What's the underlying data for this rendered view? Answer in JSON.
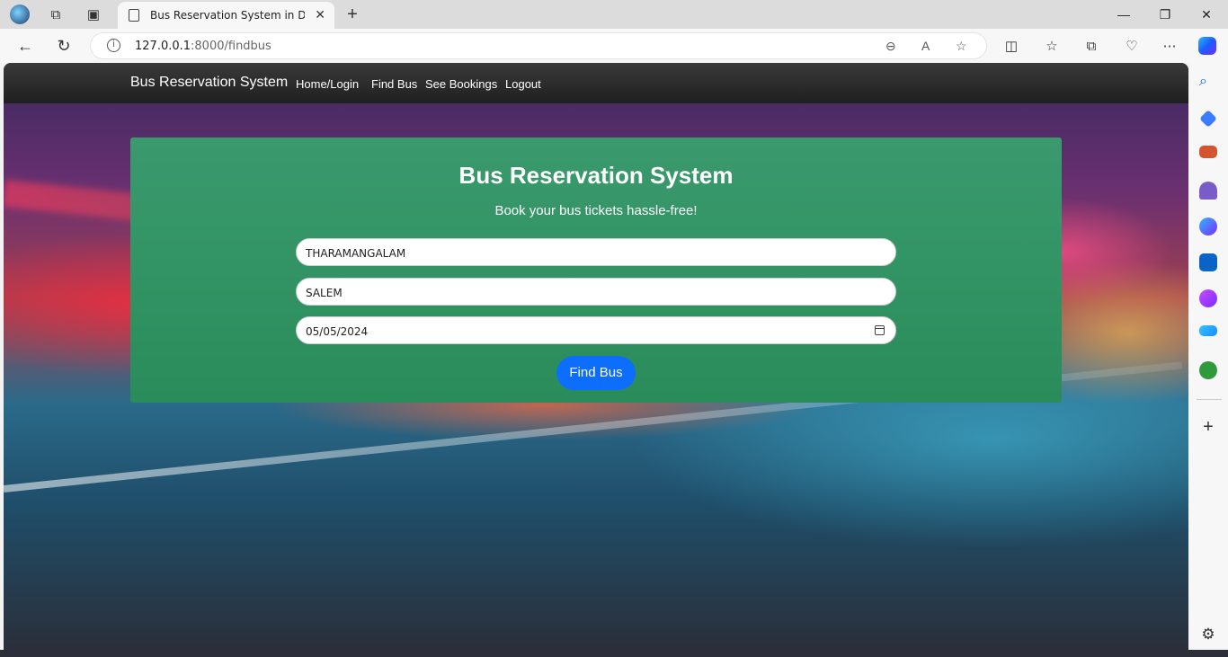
{
  "browser": {
    "tab_title": "Bus Reservation System in Django",
    "url_host": "127.0.0.1",
    "url_rest": ":8000/findbus"
  },
  "site": {
    "brand": "Bus Reservation System",
    "nav": [
      "Home/Login",
      "Find Bus",
      "See Bookings",
      "Logout"
    ]
  },
  "form": {
    "title": "Bus Reservation System",
    "subtitle": "Book your bus tickets hassle-free!",
    "source": "THARAMANGALAM",
    "destination": "SALEM",
    "date": "05/05/2024",
    "submit_label": "Find Bus"
  },
  "colors": {
    "card": "#2a8c5a",
    "button": "#0d6efd"
  }
}
